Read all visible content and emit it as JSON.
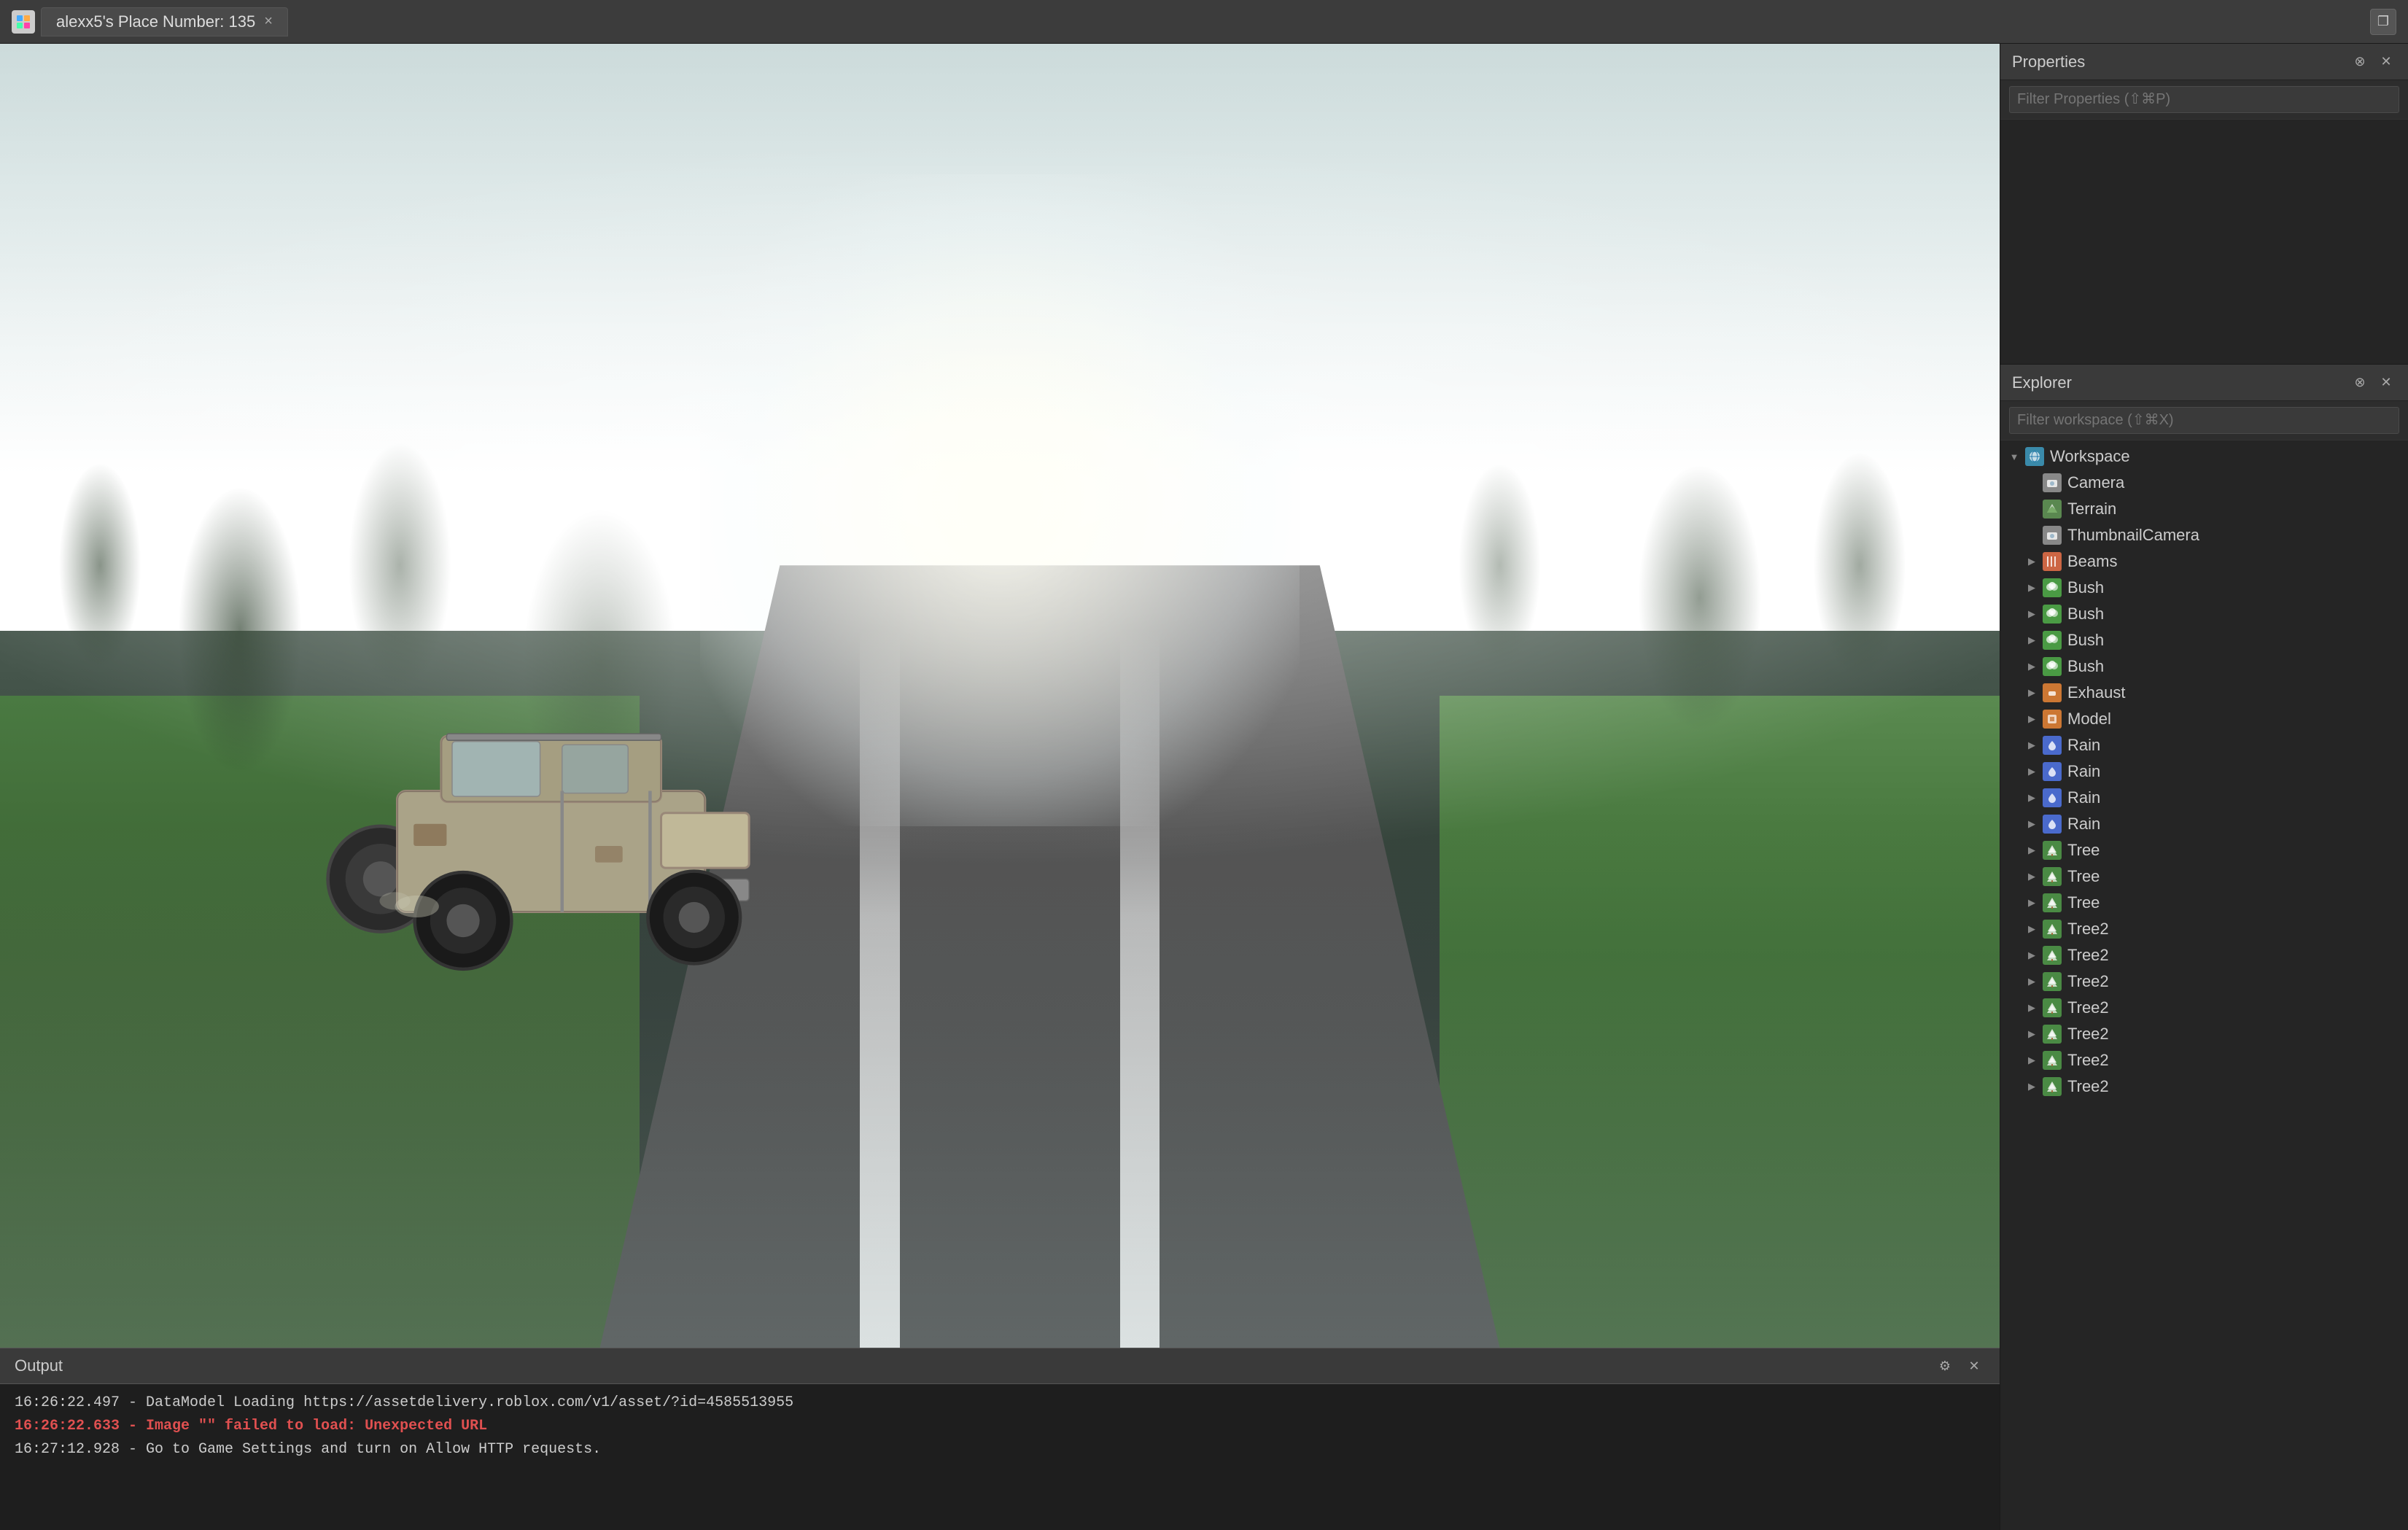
{
  "titleBar": {
    "tabLabel": "alexx5's Place Number: 135",
    "closeBtn": "×",
    "restoreBtn": "❐"
  },
  "viewport": {
    "outputTitle": "Output"
  },
  "outputLog": {
    "lines": [
      {
        "type": "normal",
        "text": "16:26:22.497 - DataModel Loading https://assetdelivery.roblox.com/v1/asset/?id=4585513955"
      },
      {
        "type": "error",
        "text": "16:26:22.633 - Image \"\" failed to load: Unexpected URL"
      },
      {
        "type": "normal",
        "text": "16:27:12.928 - Go to Game Settings and turn on Allow HTTP requests."
      }
    ]
  },
  "properties": {
    "title": "Properties",
    "filterPlaceholder": "Filter Properties (⇧⌘P)"
  },
  "explorer": {
    "title": "Explorer",
    "filterPlaceholder": "Filter workspace (⇧⌘X)",
    "items": [
      {
        "id": "workspace",
        "label": "Workspace",
        "indent": 0,
        "icon": "workspace",
        "expanded": true,
        "hasArrow": true
      },
      {
        "id": "camera",
        "label": "Camera",
        "indent": 1,
        "icon": "camera",
        "expanded": false,
        "hasArrow": false
      },
      {
        "id": "terrain",
        "label": "Terrain",
        "indent": 1,
        "icon": "terrain",
        "expanded": false,
        "hasArrow": false
      },
      {
        "id": "thumbnailcamera",
        "label": "ThumbnailCamera",
        "indent": 1,
        "icon": "thumbnail-camera",
        "expanded": false,
        "hasArrow": false
      },
      {
        "id": "beams",
        "label": "Beams",
        "indent": 1,
        "icon": "beams",
        "expanded": false,
        "hasArrow": true
      },
      {
        "id": "bush1",
        "label": "Bush",
        "indent": 1,
        "icon": "bush",
        "expanded": false,
        "hasArrow": true
      },
      {
        "id": "bush2",
        "label": "Bush",
        "indent": 1,
        "icon": "bush",
        "expanded": false,
        "hasArrow": true
      },
      {
        "id": "bush3",
        "label": "Bush",
        "indent": 1,
        "icon": "bush",
        "expanded": false,
        "hasArrow": true
      },
      {
        "id": "bush4",
        "label": "Bush",
        "indent": 1,
        "icon": "bush",
        "expanded": false,
        "hasArrow": true
      },
      {
        "id": "exhaust",
        "label": "Exhaust",
        "indent": 1,
        "icon": "exhaust",
        "expanded": false,
        "hasArrow": true
      },
      {
        "id": "model",
        "label": "Model",
        "indent": 1,
        "icon": "model",
        "expanded": false,
        "hasArrow": true
      },
      {
        "id": "rain1",
        "label": "Rain",
        "indent": 1,
        "icon": "rain",
        "expanded": false,
        "hasArrow": true
      },
      {
        "id": "rain2",
        "label": "Rain",
        "indent": 1,
        "icon": "rain",
        "expanded": false,
        "hasArrow": true
      },
      {
        "id": "rain3",
        "label": "Rain",
        "indent": 1,
        "icon": "rain",
        "expanded": false,
        "hasArrow": true
      },
      {
        "id": "rain4",
        "label": "Rain",
        "indent": 1,
        "icon": "rain",
        "expanded": false,
        "hasArrow": true
      },
      {
        "id": "tree1",
        "label": "Tree",
        "indent": 1,
        "icon": "tree",
        "expanded": false,
        "hasArrow": true
      },
      {
        "id": "tree2",
        "label": "Tree",
        "indent": 1,
        "icon": "tree",
        "expanded": false,
        "hasArrow": true
      },
      {
        "id": "tree3",
        "label": "Tree",
        "indent": 1,
        "icon": "tree",
        "expanded": false,
        "hasArrow": true
      },
      {
        "id": "tree2a",
        "label": "Tree2",
        "indent": 1,
        "icon": "tree",
        "expanded": false,
        "hasArrow": true
      },
      {
        "id": "tree2b",
        "label": "Tree2",
        "indent": 1,
        "icon": "tree",
        "expanded": false,
        "hasArrow": true
      },
      {
        "id": "tree2c",
        "label": "Tree2",
        "indent": 1,
        "icon": "tree",
        "expanded": false,
        "hasArrow": true
      },
      {
        "id": "tree2d",
        "label": "Tree2",
        "indent": 1,
        "icon": "tree",
        "expanded": false,
        "hasArrow": true
      },
      {
        "id": "tree2e",
        "label": "Tree2",
        "indent": 1,
        "icon": "tree",
        "expanded": false,
        "hasArrow": true
      },
      {
        "id": "tree2f",
        "label": "Tree2",
        "indent": 1,
        "icon": "tree",
        "expanded": false,
        "hasArrow": true
      },
      {
        "id": "tree2g",
        "label": "Tree2",
        "indent": 1,
        "icon": "tree",
        "expanded": false,
        "hasArrow": true
      }
    ]
  },
  "icons": {
    "close": "✕",
    "minimize": "○",
    "gear": "⚙",
    "circleX": "⊗",
    "circleCheck": "⊙"
  }
}
